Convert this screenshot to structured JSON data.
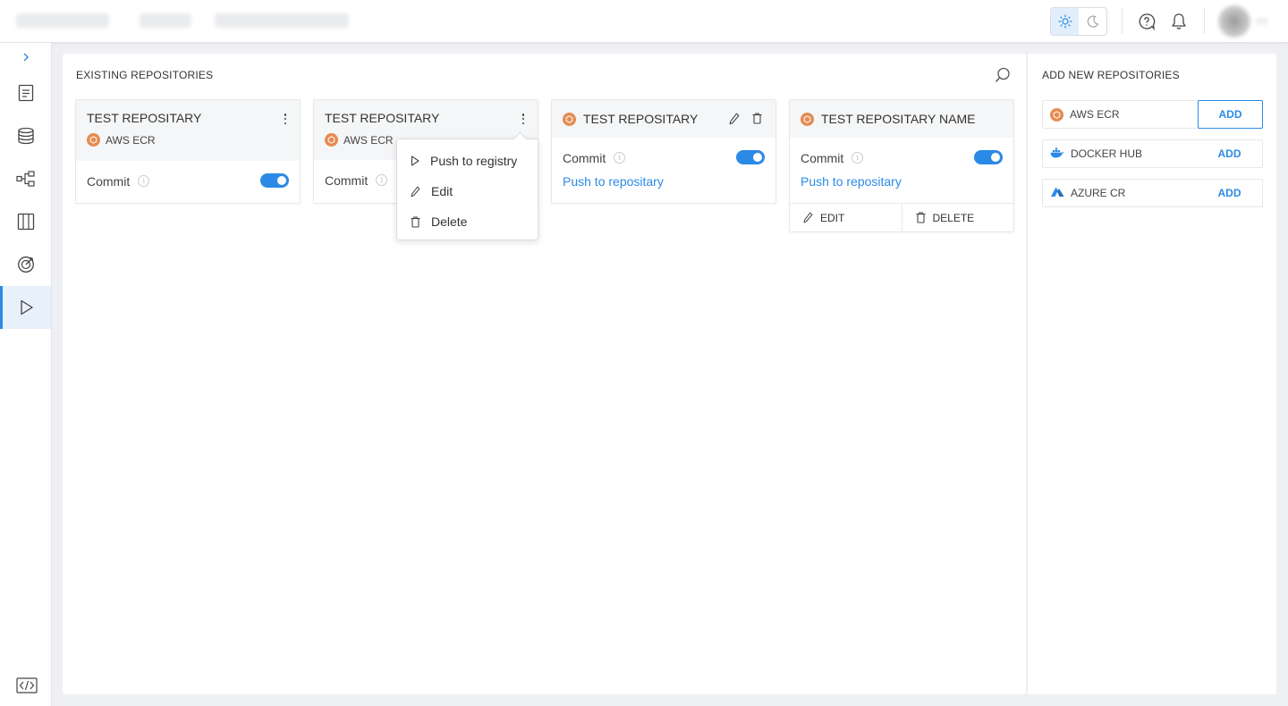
{
  "topbar": {
    "theme": {
      "light_icon": "sun-icon",
      "dark_icon": "moon-icon",
      "active": "light"
    },
    "icons": [
      "help-icon",
      "bell-icon"
    ]
  },
  "sidebar": {
    "items": [
      {
        "icon": "document-icon"
      },
      {
        "icon": "database-icon"
      },
      {
        "icon": "pipeline-icon"
      },
      {
        "icon": "columns-icon"
      },
      {
        "icon": "target-icon"
      },
      {
        "icon": "play-icon",
        "active": true
      }
    ],
    "bottom_icon": "code-icon"
  },
  "main": {
    "title": "EXISTING REPOSITORIES",
    "cards": [
      {
        "title": "TEST REPOSITARY",
        "registry": "AWS ECR",
        "commit_label": "Commit",
        "commit_on": true
      },
      {
        "title": "TEST REPOSITARY",
        "registry": "AWS ECR",
        "commit_label": "Commit",
        "commit_on": true
      },
      {
        "title": "TEST REPOSITARY",
        "commit_label": "Commit",
        "commit_on": true,
        "push_link": "Push to repositary"
      },
      {
        "title": "TEST REPOSITARY NAME",
        "commit_label": "Commit",
        "commit_on": true,
        "push_link": "Push to repositary",
        "edit_label": "EDIT",
        "delete_label": "DELETE"
      }
    ],
    "menu": {
      "items": [
        {
          "label": "Push to registry",
          "icon": "play-icon"
        },
        {
          "label": "Edit",
          "icon": "pencil-icon"
        },
        {
          "label": "Delete",
          "icon": "trash-icon"
        }
      ]
    }
  },
  "right": {
    "title": "ADD NEW REPOSITORIES",
    "registries": [
      {
        "name": "AWS ECR",
        "icon": "aws-icon",
        "add_label": "ADD"
      },
      {
        "name": "DOCKER HUB",
        "icon": "docker-icon",
        "add_label": "ADD"
      },
      {
        "name": "AZURE CR",
        "icon": "azure-icon",
        "add_label": "ADD"
      }
    ]
  },
  "colors": {
    "accent": "#2b8ae6",
    "aws": "#e58b52"
  }
}
